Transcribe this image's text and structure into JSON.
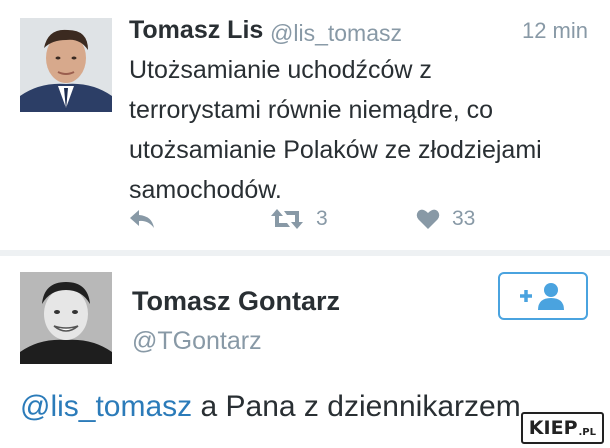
{
  "tweet1": {
    "author_name": "Tomasz Lis",
    "author_handle": "@lis_tomasz",
    "time": "12 min",
    "text_lines": [
      "Utożsamianie uchodźców z",
      "terrorystami równie niemądre, co",
      "utożsamianie Polaków ze złodziejami",
      "samochodów."
    ],
    "reply_icon": "reply-icon",
    "retweet_icon": "retweet-icon",
    "retweet_count": "3",
    "like_icon": "heart-icon",
    "like_count": "33"
  },
  "tweet2": {
    "author_name": "Tomasz Gontarz",
    "author_handle": "@TGontarz",
    "follow_icon": "add-user-icon",
    "mention": "@lis_tomasz",
    "text_rest": " a Pana z dziennikarzem"
  },
  "watermark": {
    "brand": "KIEP",
    "suffix": ".PL"
  },
  "colors": {
    "text": "#292f33",
    "muted": "#8899a6",
    "link": "#2b7bb9",
    "accent": "#4aa3df",
    "divider": "#eef1f3"
  }
}
